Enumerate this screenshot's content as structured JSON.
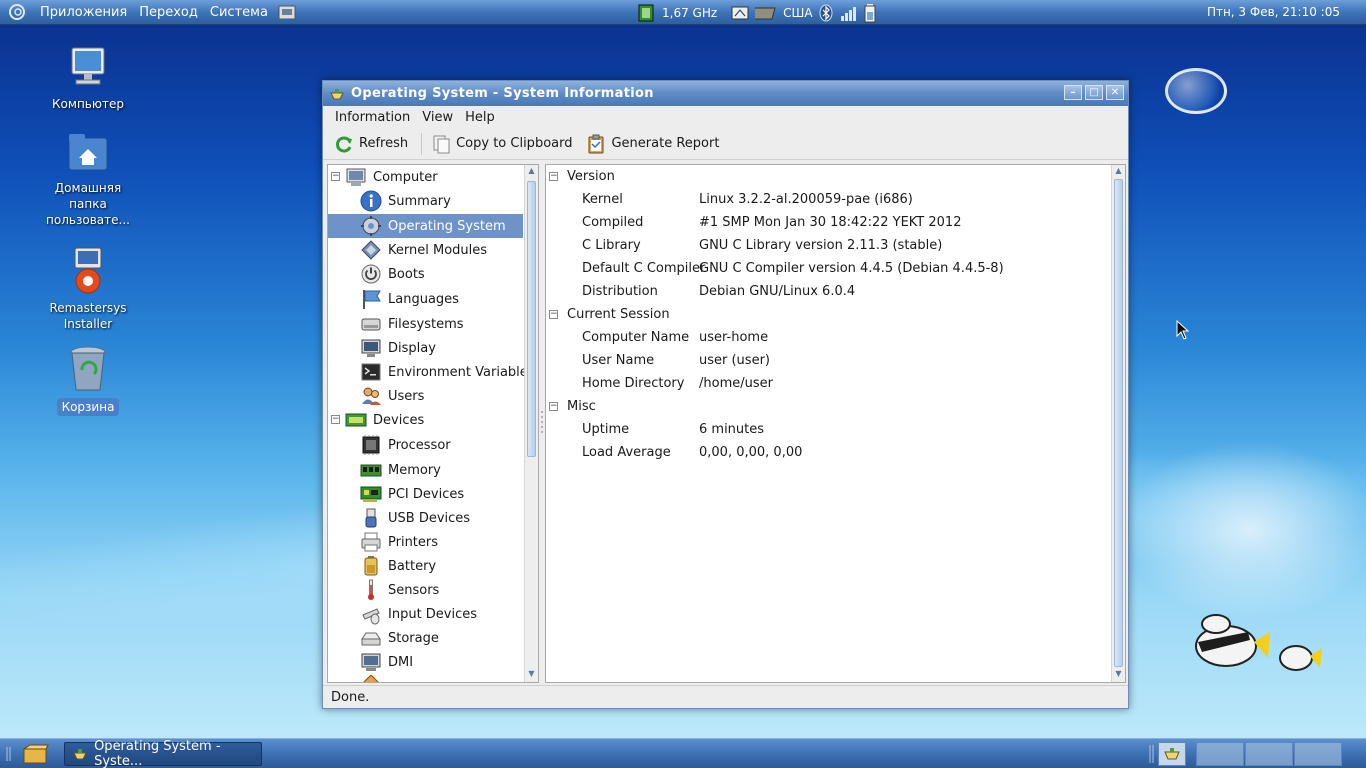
{
  "top_panel": {
    "menus": [
      "Приложения",
      "Переход",
      "Система"
    ],
    "cpu_freq": "1,67 GHz",
    "keyboard_layout": "США",
    "clock": "Птн,  3 Фев, 21:10 :05"
  },
  "desktop": {
    "icons": [
      {
        "label": "Компьютер",
        "icon": "computer-icon"
      },
      {
        "label": "Домашняя папка пользовате...",
        "icon": "home-folder-icon"
      },
      {
        "label": "Remastersys Installer",
        "icon": "installer-icon"
      },
      {
        "label": "Корзина",
        "icon": "trash-icon"
      }
    ]
  },
  "window": {
    "title": "Operating System - System Information",
    "menu": [
      "Information",
      "View",
      "Help"
    ],
    "toolbar": {
      "refresh_label": "Refresh",
      "copy_label": "Copy to Clipboard",
      "report_label": "Generate Report"
    },
    "tree": {
      "computer_group": "Computer",
      "computer_items": [
        "Summary",
        "Operating System",
        "Kernel Modules",
        "Boots",
        "Languages",
        "Filesystems",
        "Display",
        "Environment Variables",
        "Users"
      ],
      "devices_group": "Devices",
      "devices_items": [
        "Processor",
        "Memory",
        "PCI Devices",
        "USB Devices",
        "Printers",
        "Battery",
        "Sensors",
        "Input Devices",
        "Storage",
        "DMI"
      ],
      "selected": "Operating System"
    },
    "details": {
      "sections": [
        {
          "title": "Version",
          "rows": [
            {
              "key": "Kernel",
              "value": "Linux 3.2.2-al.200059-pae (i686)"
            },
            {
              "key": "Compiled",
              "value": "#1 SMP Mon Jan 30 18:42:22 YEKT 2012"
            },
            {
              "key": "C Library",
              "value": "GNU C Library version 2.11.3 (stable)"
            },
            {
              "key": "Default C Compiler",
              "value": "GNU C Compiler version 4.4.5 (Debian 4.4.5-8)"
            },
            {
              "key": "Distribution",
              "value": "Debian GNU/Linux 6.0.4"
            }
          ]
        },
        {
          "title": "Current Session",
          "rows": [
            {
              "key": "Computer Name",
              "value": "user-home"
            },
            {
              "key": "User Name",
              "value": "user (user)"
            },
            {
              "key": "Home Directory",
              "value": "/home/user"
            }
          ]
        },
        {
          "title": "Misc",
          "rows": [
            {
              "key": "Uptime",
              "value": "6 minutes"
            },
            {
              "key": "Load Average",
              "value": "0,00, 0,00, 0,00"
            }
          ]
        }
      ]
    },
    "status": "Done."
  },
  "taskbar": {
    "task_label": "Operating System - Syste..."
  },
  "colors": {
    "selection": "#6e93c9",
    "titlebar": "#5f8bc6",
    "panel": "#3f74b9"
  }
}
